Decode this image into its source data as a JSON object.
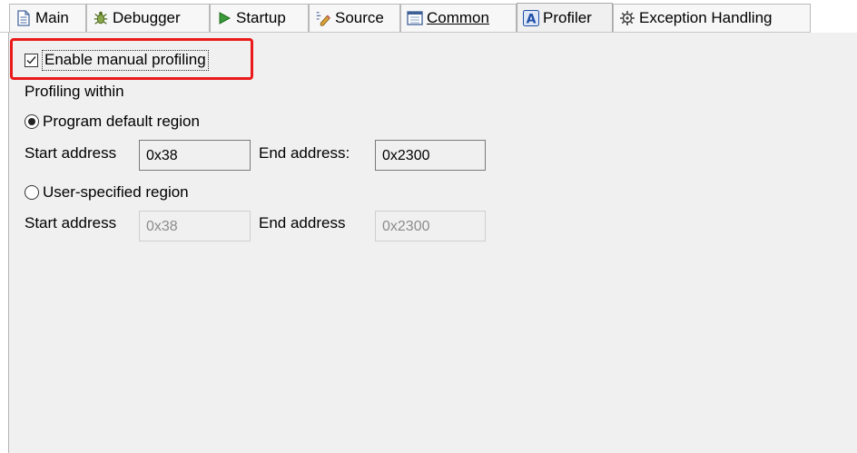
{
  "tabs": [
    {
      "label": "Main",
      "icon": "document-icon"
    },
    {
      "label": "Debugger",
      "icon": "bug-icon"
    },
    {
      "label": "Startup",
      "icon": "play-icon"
    },
    {
      "label": "Source",
      "icon": "source-icon"
    },
    {
      "label": "Common",
      "icon": "window-icon"
    },
    {
      "label": "Profiler",
      "icon": "profiler-icon"
    },
    {
      "label": "Exception Handling",
      "icon": "gear-icon"
    }
  ],
  "active_tab": "Profiler",
  "profiler": {
    "enable_manual_profiling": {
      "label": "Enable manual profiling",
      "checked": true
    },
    "profiling_within_label": "Profiling within",
    "program_default": {
      "label": "Program default region",
      "selected": true,
      "start_label": "Start address",
      "start_value": "0x38",
      "end_label": "End address:",
      "end_value": "0x2300"
    },
    "user_specified": {
      "label": "User-specified region",
      "selected": false,
      "start_label": "Start address",
      "start_value": "0x38",
      "end_label": "End address",
      "end_value": "0x2300"
    }
  },
  "colors": {
    "highlight": "#ea1a1a",
    "panel_bg": "#f0f0f0",
    "profiler_accent": "#1f4fa8"
  }
}
